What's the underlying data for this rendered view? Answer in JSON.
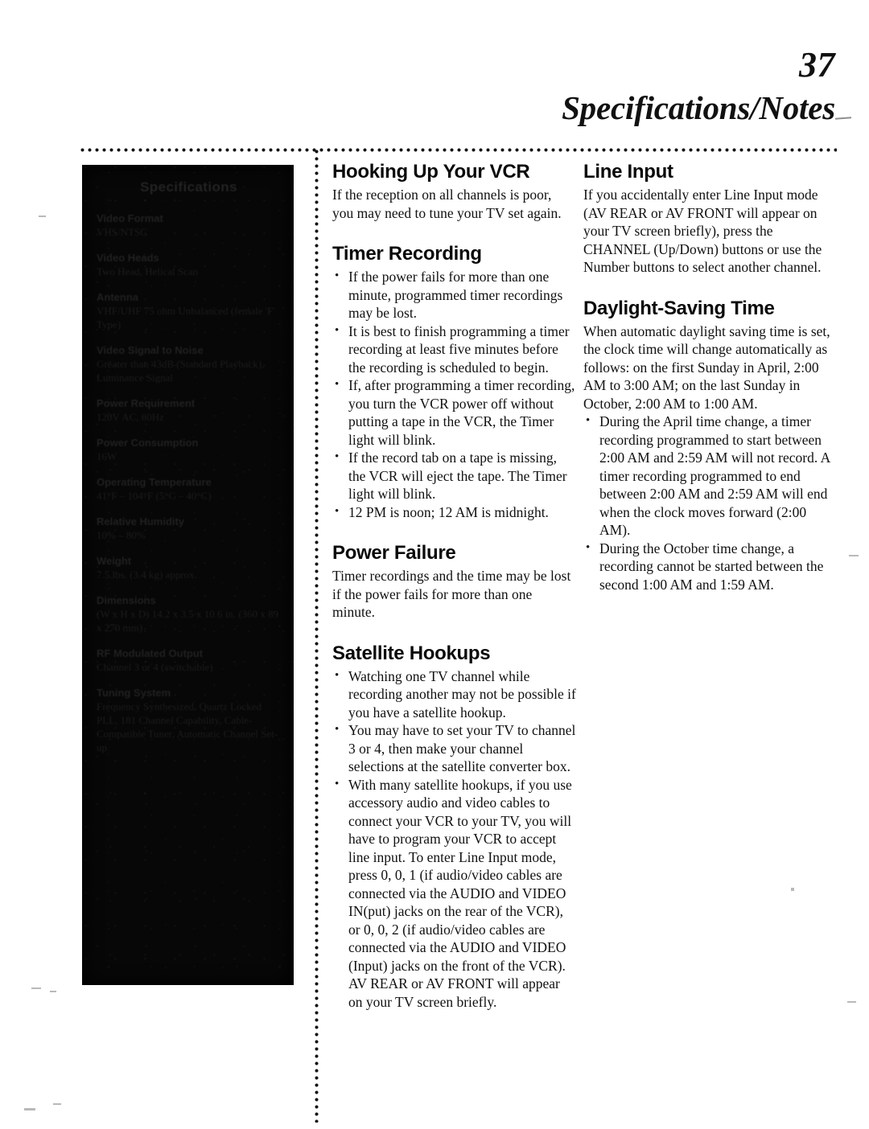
{
  "header": {
    "page_number": "37",
    "title": "Specifications/Notes"
  },
  "specifications_block": {
    "note": "over-inked scan block, text mostly illegible",
    "heading": "Specifications",
    "groups": [
      {
        "label": "Video Format",
        "value": "VHS/NTSC"
      },
      {
        "label": "Video Heads",
        "value": "Two Head, Helical Scan"
      },
      {
        "label": "Antenna",
        "value": "VHF/UHF 75 ohm Unbalanced (female 'F' Type)"
      },
      {
        "label": "Video Signal to Noise",
        "value": "Greater than 43dB (Standard Playback), Luminance Signal"
      },
      {
        "label": "Power Requirement",
        "value": "120V AC, 60Hz"
      },
      {
        "label": "Power Consumption",
        "value": "16W"
      },
      {
        "label": "Operating Temperature",
        "value": "41°F – 104°F (5°C – 40°C)"
      },
      {
        "label": "Relative Humidity",
        "value": "10% – 80%"
      },
      {
        "label": "Weight",
        "value": "7.5 lbs. (3.4 kg) approx."
      },
      {
        "label": "Dimensions",
        "value": "(W x H x D) 14.2 x 3.5 x 10.6 in. (360 x 89 x 270 mm)"
      },
      {
        "label": "RF Modulated Output",
        "value": "Channel 3 or 4 (switchable)"
      },
      {
        "label": "Tuning System",
        "value": "Frequency Synthesized, Quartz Locked PLL, 181 Channel Capability, Cable-Compatible Tuner, Automatic Channel Set-up"
      }
    ]
  },
  "columns": {
    "middle": {
      "sections": [
        {
          "heading": "Hooking Up Your VCR",
          "paragraphs": [
            "If the reception on all channels is poor, you may need to tune your TV set again."
          ],
          "bullets": []
        },
        {
          "heading": "Timer Recording",
          "paragraphs": [],
          "bullets": [
            "If the power fails for more than one minute, programmed timer recordings may be lost.",
            "It is best to finish programming a timer recording at least five minutes before the recording is scheduled to begin.",
            "If, after programming a timer recording, you turn the VCR power off without putting a tape in the VCR, the Timer light will blink.",
            "If the record tab on a tape is missing, the VCR will eject the tape.  The Timer light will blink.",
            "12 PM is noon; 12 AM is midnight."
          ]
        },
        {
          "heading": "Power Failure",
          "paragraphs": [
            "Timer recordings and the time may be lost if the power fails for more than one minute."
          ],
          "bullets": []
        },
        {
          "heading": "Satellite Hookups",
          "paragraphs": [],
          "bullets": [
            "Watching one TV channel while recording another may not be possible if you have a satellite hookup.",
            "You may have to set your TV to channel 3 or 4, then make your channel selections at the satellite converter box.",
            "With many satellite hookups, if you use accessory audio and video cables to connect your VCR to your TV, you will have to program your VCR to accept line input.  To enter Line Input mode, press 0, 0, 1 (if audio/video cables are connected via the AUDIO and VIDEO IN(put) jacks on the rear of the VCR), or 0, 0, 2 (if audio/video cables are connected via the AUDIO and VIDEO (Input) jacks on the front of the VCR).  AV REAR or AV FRONT will appear on your TV screen briefly."
          ]
        }
      ]
    },
    "right": {
      "sections": [
        {
          "heading": "Line Input",
          "paragraphs": [
            "If you accidentally enter Line Input mode (AV REAR or AV FRONT will appear on your TV screen briefly), press the CHANNEL (Up/Down) buttons or use the Number buttons to select another channel."
          ],
          "bullets": []
        },
        {
          "heading": "Daylight-Saving Time",
          "paragraphs": [
            "When automatic daylight saving time is set, the clock time will change automatically as follows: on the first Sunday in April, 2:00 AM to 3:00 AM; on the last Sunday in October, 2:00 AM to 1:00 AM."
          ],
          "bullets": [
            "During the April time change, a timer recording programmed to start between 2:00 AM and 2:59 AM will not record.  A timer recording programmed to end between 2:00 AM and 2:59 AM will end when the clock moves forward (2:00 AM).",
            "During the October time change, a recording cannot be started between the second 1:00 AM and 1:59 AM."
          ]
        }
      ]
    }
  }
}
